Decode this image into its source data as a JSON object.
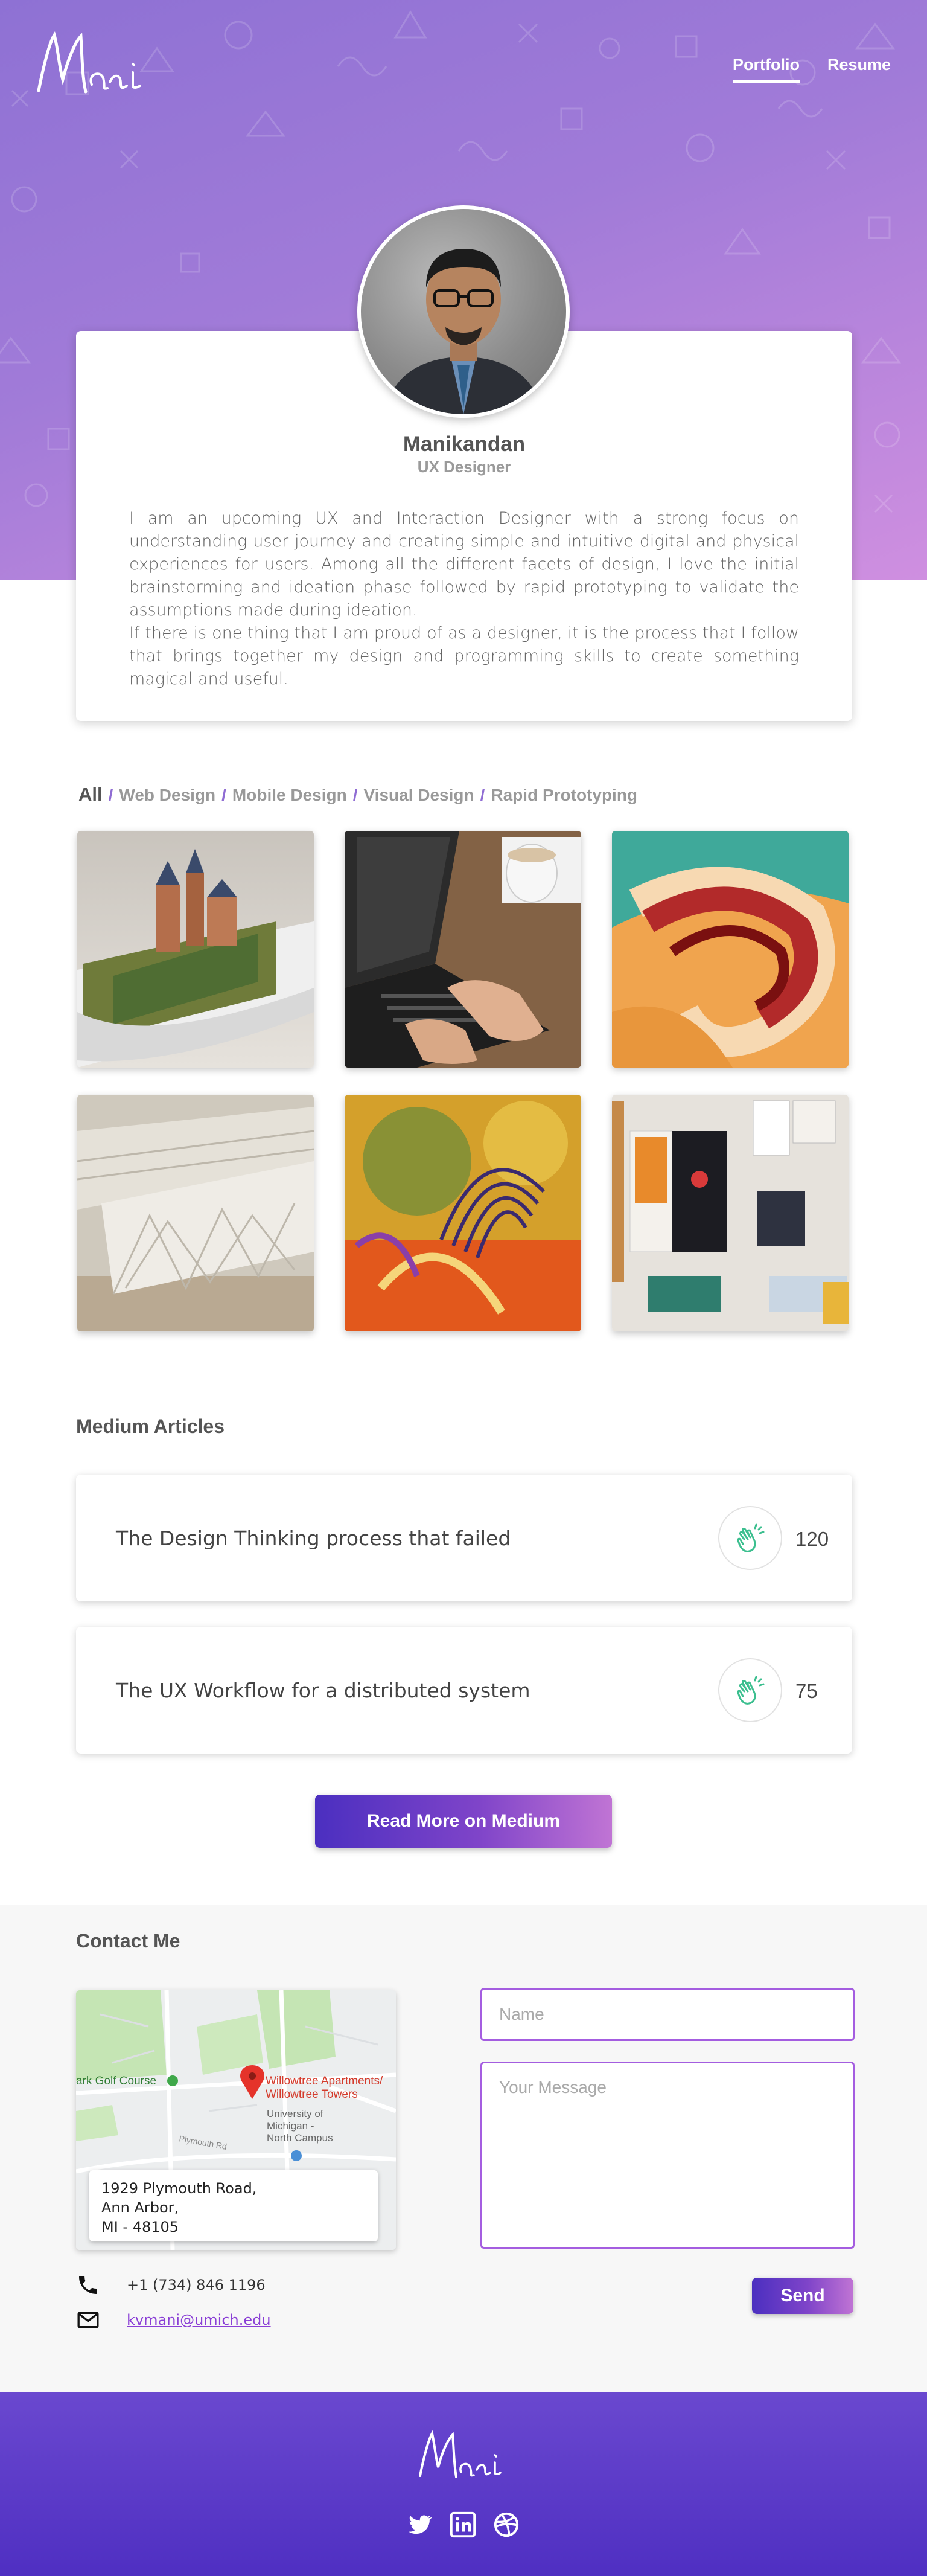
{
  "header": {
    "logo_text": "Mani",
    "nav": [
      {
        "label": "Portfolio",
        "active": true
      },
      {
        "label": "Resume",
        "active": false
      }
    ]
  },
  "profile": {
    "name": "Manikandan",
    "role": "UX Designer",
    "bio": [
      "I am an upcoming UX and Interaction Designer with a strong focus on understanding user journey and creating simple and intuitive digital and physical experiences for users. Among all the different facets of design, I love the initial brainstorming and ideation phase followed by rapid prototyping to validate the assumptions made during ideation.",
      "If there is one thing that I am proud of as a designer, it is the process that I follow that brings together my design and programming skills to create something magical and useful."
    ]
  },
  "portfolio": {
    "filters": [
      "All",
      "Web Design",
      "Mobile Design",
      "Visual Design",
      "Rapid Prototyping"
    ],
    "active_filter": "All",
    "separator": "/",
    "tiles": [
      {
        "icon": "castle-on-phone-image"
      },
      {
        "icon": "laptop-typing-image"
      },
      {
        "icon": "abstract-swirl-image"
      },
      {
        "icon": "architecture-model-image"
      },
      {
        "icon": "fractal-art-image"
      },
      {
        "icon": "ui-wireframes-wall-image"
      }
    ]
  },
  "medium": {
    "section_title": "Medium Articles",
    "articles": [
      {
        "title": "The Design Thinking process that failed",
        "claps": "120"
      },
      {
        "title": "The UX Workflow for a distributed system",
        "claps": "75"
      }
    ],
    "button_label": "Read More on Medium"
  },
  "contact": {
    "section_title": "Contact Me",
    "map": {
      "label_golf": "ark Golf Course",
      "label_place_1": "Willowtree Apartments/",
      "label_place_2": "Willowtree Towers",
      "label_campus_1": "University of",
      "label_campus_2": "Michigan -",
      "label_campus_3": "North Campus",
      "label_street": "Plymouth Rd"
    },
    "address_lines": [
      "1929 Plymouth Road,",
      "Ann Arbor,",
      "MI - 48105"
    ],
    "phone": "+1 (734) 846 1196",
    "email": "kvmani@umich.edu",
    "name_placeholder": "Name",
    "message_placeholder": "Your Message",
    "send_label": "Send"
  },
  "footer": {
    "logo_text": "Mani",
    "social": [
      "twitter-icon",
      "linkedin-icon",
      "dribbble-icon"
    ]
  },
  "colors": {
    "accent_purple": "#8a3fd6",
    "hero_gradient_start": "#8e71d4",
    "hero_gradient_end": "#cf8fe0",
    "button_gradient_start": "#4b2fc0",
    "button_gradient_end": "#c074d4",
    "clap_green": "#3cbf8f"
  }
}
